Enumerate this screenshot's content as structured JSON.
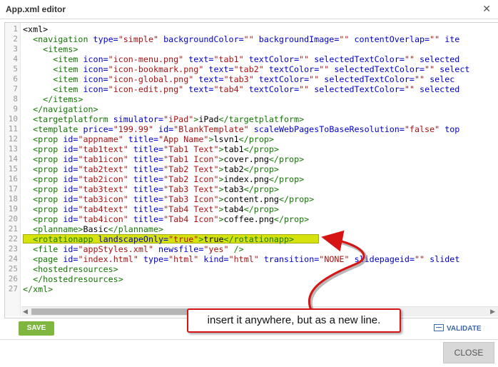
{
  "dialog": {
    "title": "App.xml editor",
    "close_icon": "close-x-icon"
  },
  "editor": {
    "line_numbers": [
      "1",
      "2",
      "3",
      "4",
      "5",
      "6",
      "7",
      "8",
      "9",
      "10",
      "11",
      "12",
      "13",
      "14",
      "15",
      "16",
      "17",
      "18",
      "19",
      "20",
      "21",
      "22",
      "23",
      "24",
      "25",
      "26",
      "27"
    ],
    "lines": [
      [
        [
          "x",
          "<xml>"
        ]
      ],
      [
        [
          "x",
          "  "
        ],
        [
          "t",
          "<navigation"
        ],
        [
          "x",
          " "
        ],
        [
          "a",
          "type="
        ],
        [
          "v",
          "\"simple\""
        ],
        [
          "x",
          " "
        ],
        [
          "a",
          "backgroundColor="
        ],
        [
          "v",
          "\"\""
        ],
        [
          "x",
          " "
        ],
        [
          "a",
          "backgroundImage="
        ],
        [
          "v",
          "\"\""
        ],
        [
          "x",
          " "
        ],
        [
          "a",
          "contentOverlap="
        ],
        [
          "v",
          "\"\""
        ],
        [
          "x",
          " "
        ],
        [
          "a",
          "ite"
        ]
      ],
      [
        [
          "x",
          "    "
        ],
        [
          "t",
          "<items>"
        ]
      ],
      [
        [
          "x",
          "      "
        ],
        [
          "t",
          "<item"
        ],
        [
          "x",
          " "
        ],
        [
          "a",
          "icon="
        ],
        [
          "v",
          "\"icon-menu.png\""
        ],
        [
          "x",
          " "
        ],
        [
          "a",
          "text="
        ],
        [
          "v",
          "\"tab1\""
        ],
        [
          "x",
          " "
        ],
        [
          "a",
          "textColor="
        ],
        [
          "v",
          "\"\""
        ],
        [
          "x",
          " "
        ],
        [
          "a",
          "selectedTextColor="
        ],
        [
          "v",
          "\"\""
        ],
        [
          "x",
          " "
        ],
        [
          "a",
          "selected"
        ]
      ],
      [
        [
          "x",
          "      "
        ],
        [
          "t",
          "<item"
        ],
        [
          "x",
          " "
        ],
        [
          "a",
          "icon="
        ],
        [
          "v",
          "\"icon-bookmark.png\""
        ],
        [
          "x",
          " "
        ],
        [
          "a",
          "text="
        ],
        [
          "v",
          "\"tab2\""
        ],
        [
          "x",
          " "
        ],
        [
          "a",
          "textColor="
        ],
        [
          "v",
          "\"\""
        ],
        [
          "x",
          " "
        ],
        [
          "a",
          "selectedTextColor="
        ],
        [
          "v",
          "\"\""
        ],
        [
          "x",
          " "
        ],
        [
          "a",
          "select"
        ]
      ],
      [
        [
          "x",
          "      "
        ],
        [
          "t",
          "<item"
        ],
        [
          "x",
          " "
        ],
        [
          "a",
          "icon="
        ],
        [
          "v",
          "\"icon-global.png\""
        ],
        [
          "x",
          " "
        ],
        [
          "a",
          "text="
        ],
        [
          "v",
          "\"tab3\""
        ],
        [
          "x",
          " "
        ],
        [
          "a",
          "textColor="
        ],
        [
          "v",
          "\"\""
        ],
        [
          "x",
          " "
        ],
        [
          "a",
          "selectedTextColor="
        ],
        [
          "v",
          "\"\""
        ],
        [
          "x",
          " "
        ],
        [
          "a",
          "selec"
        ]
      ],
      [
        [
          "x",
          "      "
        ],
        [
          "t",
          "<item"
        ],
        [
          "x",
          " "
        ],
        [
          "a",
          "icon="
        ],
        [
          "v",
          "\"icon-edit.png\""
        ],
        [
          "x",
          " "
        ],
        [
          "a",
          "text="
        ],
        [
          "v",
          "\"tab4\""
        ],
        [
          "x",
          " "
        ],
        [
          "a",
          "textColor="
        ],
        [
          "v",
          "\"\""
        ],
        [
          "x",
          " "
        ],
        [
          "a",
          "selectedTextColor="
        ],
        [
          "v",
          "\"\""
        ],
        [
          "x",
          " "
        ],
        [
          "a",
          "selected"
        ]
      ],
      [
        [
          "x",
          "    "
        ],
        [
          "t",
          "</items>"
        ]
      ],
      [
        [
          "x",
          "  "
        ],
        [
          "t",
          "</navigation>"
        ]
      ],
      [
        [
          "x",
          "  "
        ],
        [
          "t",
          "<targetplatform"
        ],
        [
          "x",
          " "
        ],
        [
          "a",
          "simulator="
        ],
        [
          "v",
          "\"iPad\""
        ],
        [
          "t",
          ">"
        ],
        [
          "x",
          "iPad"
        ],
        [
          "t",
          "</targetplatform>"
        ]
      ],
      [
        [
          "x",
          "  "
        ],
        [
          "t",
          "<template"
        ],
        [
          "x",
          " "
        ],
        [
          "a",
          "price="
        ],
        [
          "v",
          "\"199.99\""
        ],
        [
          "x",
          " "
        ],
        [
          "a",
          "id="
        ],
        [
          "v",
          "\"BlankTemplate\""
        ],
        [
          "x",
          " "
        ],
        [
          "a",
          "scaleWebPagesToBaseResolution="
        ],
        [
          "v",
          "\"false\""
        ],
        [
          "x",
          " "
        ],
        [
          "a",
          "top"
        ]
      ],
      [
        [
          "x",
          "  "
        ],
        [
          "t",
          "<prop"
        ],
        [
          "x",
          " "
        ],
        [
          "a",
          "id="
        ],
        [
          "v",
          "\"appname\""
        ],
        [
          "x",
          " "
        ],
        [
          "a",
          "title="
        ],
        [
          "v",
          "\"App Name\""
        ],
        [
          "t",
          ">"
        ],
        [
          "x",
          "lsvn1"
        ],
        [
          "t",
          "</prop>"
        ]
      ],
      [
        [
          "x",
          "  "
        ],
        [
          "t",
          "<prop"
        ],
        [
          "x",
          " "
        ],
        [
          "a",
          "id="
        ],
        [
          "v",
          "\"tab1text\""
        ],
        [
          "x",
          " "
        ],
        [
          "a",
          "title="
        ],
        [
          "v",
          "\"Tab1 Text\""
        ],
        [
          "t",
          ">"
        ],
        [
          "x",
          "tab1"
        ],
        [
          "t",
          "</prop>"
        ]
      ],
      [
        [
          "x",
          "  "
        ],
        [
          "t",
          "<prop"
        ],
        [
          "x",
          " "
        ],
        [
          "a",
          "id="
        ],
        [
          "v",
          "\"tab1icon\""
        ],
        [
          "x",
          " "
        ],
        [
          "a",
          "title="
        ],
        [
          "v",
          "\"Tab1 Icon\""
        ],
        [
          "t",
          ">"
        ],
        [
          "x",
          "cover.png"
        ],
        [
          "t",
          "</prop>"
        ]
      ],
      [
        [
          "x",
          "  "
        ],
        [
          "t",
          "<prop"
        ],
        [
          "x",
          " "
        ],
        [
          "a",
          "id="
        ],
        [
          "v",
          "\"tab2text\""
        ],
        [
          "x",
          " "
        ],
        [
          "a",
          "title="
        ],
        [
          "v",
          "\"Tab2 Text\""
        ],
        [
          "t",
          ">"
        ],
        [
          "x",
          "tab2"
        ],
        [
          "t",
          "</prop>"
        ]
      ],
      [
        [
          "x",
          "  "
        ],
        [
          "t",
          "<prop"
        ],
        [
          "x",
          " "
        ],
        [
          "a",
          "id="
        ],
        [
          "v",
          "\"tab2icon\""
        ],
        [
          "x",
          " "
        ],
        [
          "a",
          "title="
        ],
        [
          "v",
          "\"Tab2 Icon\""
        ],
        [
          "t",
          ">"
        ],
        [
          "x",
          "index.png"
        ],
        [
          "t",
          "</prop>"
        ]
      ],
      [
        [
          "x",
          "  "
        ],
        [
          "t",
          "<prop"
        ],
        [
          "x",
          " "
        ],
        [
          "a",
          "id="
        ],
        [
          "v",
          "\"tab3text\""
        ],
        [
          "x",
          " "
        ],
        [
          "a",
          "title="
        ],
        [
          "v",
          "\"Tab3 Text\""
        ],
        [
          "t",
          ">"
        ],
        [
          "x",
          "tab3"
        ],
        [
          "t",
          "</prop>"
        ]
      ],
      [
        [
          "x",
          "  "
        ],
        [
          "t",
          "<prop"
        ],
        [
          "x",
          " "
        ],
        [
          "a",
          "id="
        ],
        [
          "v",
          "\"tab3icon\""
        ],
        [
          "x",
          " "
        ],
        [
          "a",
          "title="
        ],
        [
          "v",
          "\"Tab3 Icon\""
        ],
        [
          "t",
          ">"
        ],
        [
          "x",
          "content.png"
        ],
        [
          "t",
          "</prop>"
        ]
      ],
      [
        [
          "x",
          "  "
        ],
        [
          "t",
          "<prop"
        ],
        [
          "x",
          " "
        ],
        [
          "a",
          "id="
        ],
        [
          "v",
          "\"tab4text\""
        ],
        [
          "x",
          " "
        ],
        [
          "a",
          "title="
        ],
        [
          "v",
          "\"Tab4 Text\""
        ],
        [
          "t",
          ">"
        ],
        [
          "x",
          "tab4"
        ],
        [
          "t",
          "</prop>"
        ]
      ],
      [
        [
          "x",
          "  "
        ],
        [
          "t",
          "<prop"
        ],
        [
          "x",
          " "
        ],
        [
          "a",
          "id="
        ],
        [
          "v",
          "\"tab4icon\""
        ],
        [
          "x",
          " "
        ],
        [
          "a",
          "title="
        ],
        [
          "v",
          "\"Tab4 Icon\""
        ],
        [
          "t",
          ">"
        ],
        [
          "x",
          "coffee.png"
        ],
        [
          "t",
          "</prop>"
        ]
      ],
      [
        [
          "x",
          "  "
        ],
        [
          "t",
          "<planname>"
        ],
        [
          "x",
          "Basic"
        ],
        [
          "t",
          "</planname>"
        ]
      ],
      [
        [
          "x",
          "  "
        ],
        [
          "t",
          "<rotationapp"
        ],
        [
          "x",
          " "
        ],
        [
          "a",
          "landscapeOnly="
        ],
        [
          "v",
          "\"true\""
        ],
        [
          "t",
          ">"
        ],
        [
          "x",
          "true"
        ],
        [
          "t",
          "</rotationapp>"
        ]
      ],
      [
        [
          "x",
          "  "
        ],
        [
          "t",
          "<file"
        ],
        [
          "x",
          " "
        ],
        [
          "a",
          "id="
        ],
        [
          "v",
          "\"appStyles.xml\""
        ],
        [
          "x",
          " "
        ],
        [
          "a",
          "newsfile="
        ],
        [
          "v",
          "\"yes\""
        ],
        [
          "x",
          " "
        ],
        [
          "t",
          "/>"
        ]
      ],
      [
        [
          "x",
          "  "
        ],
        [
          "t",
          "<page"
        ],
        [
          "x",
          " "
        ],
        [
          "a",
          "id="
        ],
        [
          "v",
          "\"index.html\""
        ],
        [
          "x",
          " "
        ],
        [
          "a",
          "type="
        ],
        [
          "v",
          "\"html\""
        ],
        [
          "x",
          " "
        ],
        [
          "a",
          "kind="
        ],
        [
          "v",
          "\"html\""
        ],
        [
          "x",
          " "
        ],
        [
          "a",
          "transition="
        ],
        [
          "v",
          "\"NONE\""
        ],
        [
          "x",
          " "
        ],
        [
          "a",
          "slidepageid="
        ],
        [
          "v",
          "\"\""
        ],
        [
          "x",
          " "
        ],
        [
          "a",
          "slidet"
        ]
      ],
      [
        [
          "x",
          "  "
        ],
        [
          "t",
          "<hostedresources>"
        ]
      ],
      [
        [
          "x",
          "  "
        ],
        [
          "t",
          "</hostedresources>"
        ]
      ],
      [
        [
          "x",
          ""
        ],
        [
          "t",
          "</xml>"
        ]
      ]
    ],
    "highlighted_line": 22
  },
  "toolbar": {
    "save_label": "SAVE",
    "validate_label": "VALIDATE",
    "validate_icon": "keyboard-icon"
  },
  "footer": {
    "close_label": "CLOSE"
  },
  "annotation": {
    "callout_text": "insert it anywhere, but as a new line.",
    "border_color": "#d61414"
  },
  "colors": {
    "save_green": "#7fb63f",
    "highlight_yellow": "#d6e20e",
    "tag_green": "#117700",
    "attr_blue": "#0000cc",
    "value_red": "#aa1111"
  }
}
